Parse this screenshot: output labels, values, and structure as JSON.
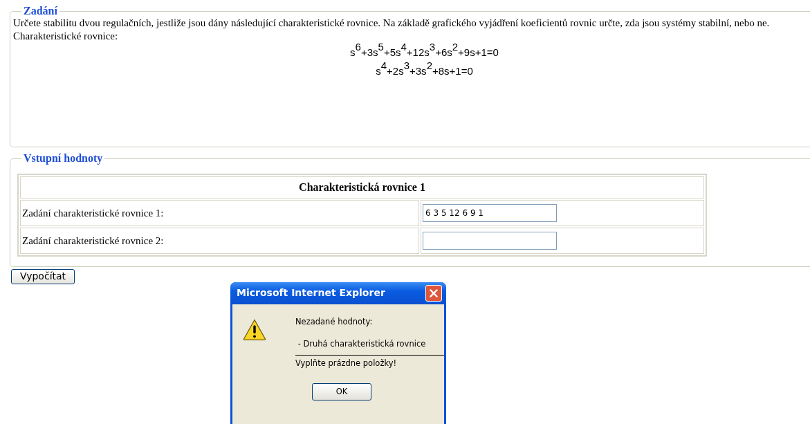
{
  "assignment": {
    "legend": "Zadání",
    "text": "Určete stabilitu dvou regulačních, jestliže jsou dány následující charakteristické rovnice. Na základě grafického vyjádření koeficientů rovnic určte, zda jsou systémy stabilní, nebo ne.",
    "equations_label": "Charakteristické rovnice:",
    "equations": [
      "s$^{6}$+3s$^{5}$+5s$^{4}$+12s$^{3}$+6s$^{2}$+9s+1=0",
      "s$^{4}$+2s$^{3}$+3s$^{2}$+8s+1=0"
    ]
  },
  "inputs": {
    "legend": "Vstupní hodnoty",
    "table_title": "Charakteristická rovnice 1",
    "rows": [
      {
        "label": "Zadání charakteristické rovnice 1:",
        "value": "6 3 5 12 6 9 1"
      },
      {
        "label": "Zadání charakteristické rovnice 2:"
      }
    ]
  },
  "calculate_button": "Vypočítat",
  "dialog": {
    "title": "Microsoft Internet Explorer",
    "heading": "Nezadané hodnoty:",
    "item": " - Druhá charakteristická rovnice",
    "instruction": "Vyplňte prázdne položky!",
    "ok_button": "OK"
  }
}
